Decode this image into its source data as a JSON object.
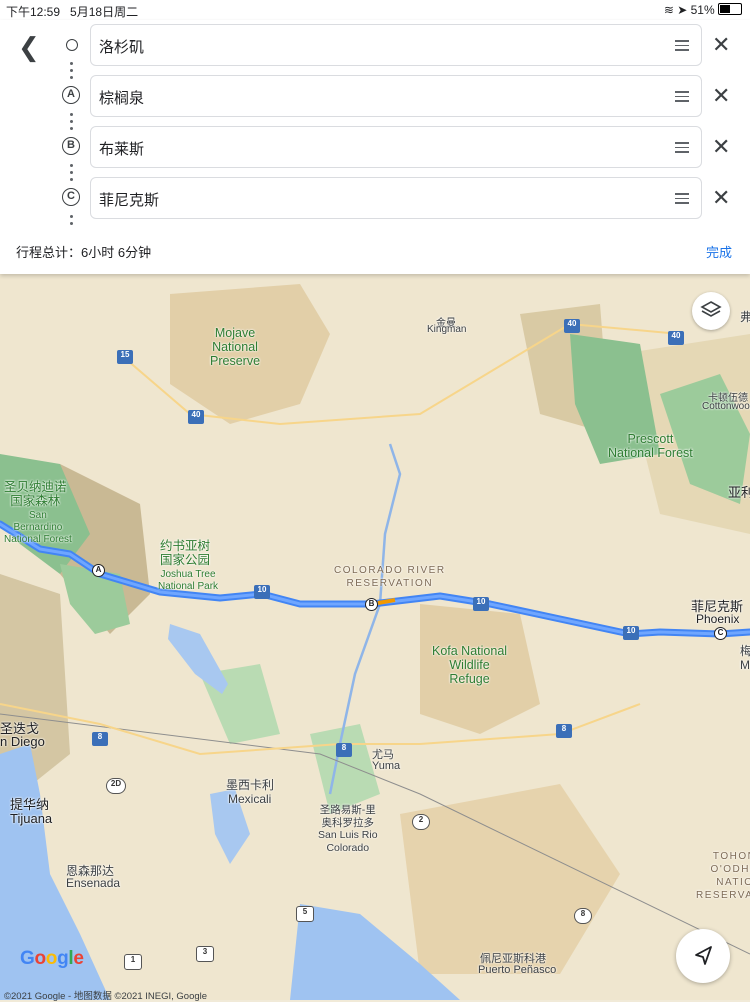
{
  "status_bar": {
    "time": "下午12:59",
    "date": "5月18日周二",
    "battery": "51%"
  },
  "stops": [
    {
      "marker": "",
      "name": "洛杉矶"
    },
    {
      "marker": "A",
      "name": "棕榈泉"
    },
    {
      "marker": "B",
      "name": "布莱斯"
    },
    {
      "marker": "C",
      "name": "菲尼克斯"
    }
  ],
  "summary": "行程总计：6小时 6分钟",
  "done_label": "完成",
  "map": {
    "labels": {
      "mojave": "Mojave\nNational\nPreserve",
      "kingman_cn": "金曼",
      "kingman": "Kingman",
      "prescott": "Prescott\nNational Forest",
      "cottonwood_cn": "卡顿伍德",
      "cottonwood": "Cottonwood",
      "sanbern_cn": "圣贝纳迪诺\n国家森林",
      "sanbern": "San\nBernardino\nNational Forest",
      "joshua_cn": "约书亚树\n国家公园",
      "joshua": "Joshua Tree\nNational Park",
      "colorado_res": "COLORADO RIVER\nRESERVATION",
      "phoenix_cn": "菲尼克斯",
      "phoenix": "Phoenix",
      "kofa": "Kofa National\nWildlife\nRefuge",
      "sandiego_cn": "圣迭戈",
      "sandiego": "n Diego",
      "yuma_cn": "尤马",
      "yuma": "Yuma",
      "mexicali_cn": "墨西卡利",
      "mexicali": "Mexicali",
      "tijuana_cn": "提华纳",
      "tijuana": "Tijuana",
      "slrc": "圣路易斯-里\n奥科罗拉多\nSan Luis Rio\nColorado",
      "ensenada_cn": "恩森那达",
      "ensenada": "Ensenada",
      "penasco_cn": "佩尼亚斯科港",
      "penasco": "Puerto Peñasco",
      "tohono": "TOHONO\nO'ODHAM\nNATION\nRESERVATION",
      "edge_a": "亚利",
      "edge_b": "梅",
      "edge_c": "M",
      "edge_d": "弗"
    },
    "shields": [
      "15",
      "40",
      "40",
      "40",
      "10",
      "10",
      "10",
      "8",
      "8",
      "8",
      "2",
      "5",
      "1",
      "3",
      "8",
      "2D"
    ],
    "markers": [
      "A",
      "B",
      "C"
    ],
    "google_logo": "Google",
    "copyright": "©2021 Google - 地图数据 ©2021 INEGI, Google"
  }
}
